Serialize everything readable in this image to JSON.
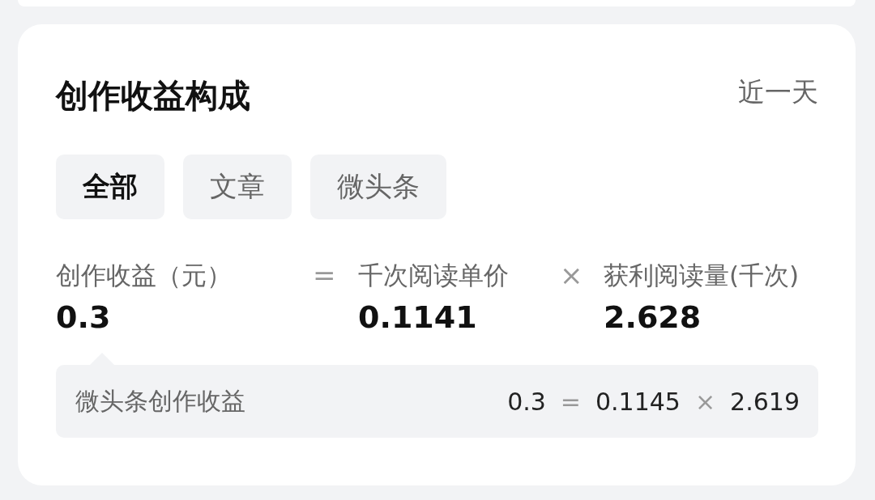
{
  "title": "创作收益构成",
  "period": "近一天",
  "tabs": [
    {
      "label": "全部",
      "selected": true
    },
    {
      "label": "文章",
      "selected": false
    },
    {
      "label": "微头条",
      "selected": false
    }
  ],
  "formula": {
    "terms": [
      {
        "label": "创作收益（元）",
        "value": "0.3"
      },
      {
        "label": "千次阅读单价",
        "value": "0.1141"
      },
      {
        "label": "获利阅读量(千次)",
        "value": "2.628"
      }
    ],
    "operators": [
      "=",
      "×"
    ]
  },
  "breakdown": [
    {
      "label": "微头条创作收益",
      "result": "0.3",
      "equals": "=",
      "price": "0.1145",
      "times": "×",
      "reads": "2.619"
    }
  ]
}
